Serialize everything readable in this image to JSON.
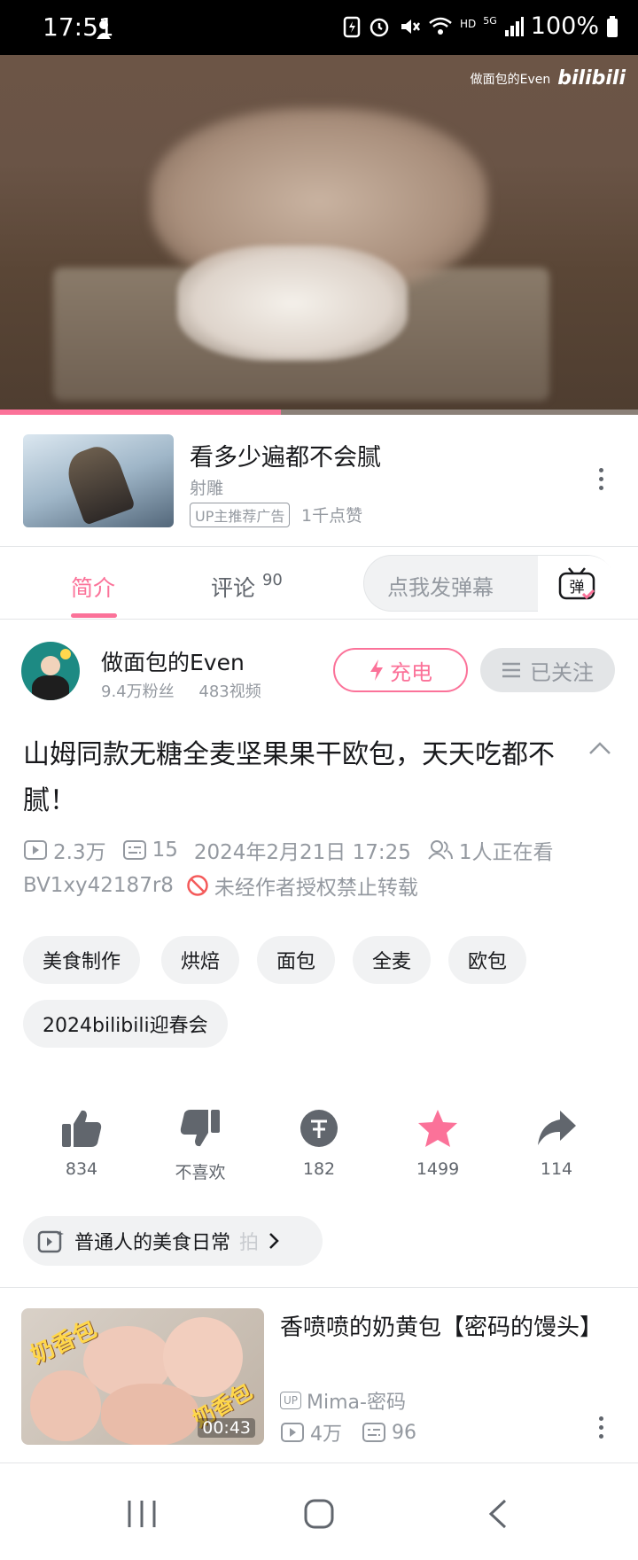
{
  "status_bar": {
    "time": "17:51",
    "network": "5G",
    "hd": "HD",
    "battery": "100%"
  },
  "player": {
    "watermark_name": "做面包的Even",
    "watermark_logo": "bilibili",
    "progress_fraction": 0.44
  },
  "ad": {
    "title": "看多少遍都不会腻",
    "subtitle": "射雕",
    "badge": "UP主推荐广告",
    "likes": "1千点赞"
  },
  "tabs": {
    "intro": "简介",
    "comments": "评论",
    "comments_count": "90",
    "danmaku_placeholder": "点我发弹幕",
    "danmaku_icon_char": "弹"
  },
  "uploader": {
    "name": "做面包的Even",
    "fans": "9.4万粉丝",
    "videos": "483视频",
    "charge_label": "充电",
    "follow_label": "已关注"
  },
  "video": {
    "title": "山姆同款无糖全麦坚果果干欧包，天天吃都不腻！",
    "plays": "2.3万",
    "danmaku": "15",
    "date": "2024年2月21日 17:25",
    "watching": "1人正在看",
    "bvid": "BV1xy42187r8",
    "repost_notice": "未经作者授权禁止转载",
    "tags": [
      "美食制作",
      "烘焙",
      "面包",
      "全麦",
      "欧包",
      "2024bilibili迎春会"
    ]
  },
  "actions": {
    "like": "834",
    "dislike": "不喜欢",
    "coin": "182",
    "favorite": "1499",
    "share": "114"
  },
  "playlist": {
    "label": "普通人的美食日常",
    "fade_char": "拍"
  },
  "recommended": {
    "title": "香喷喷的奶黄包【密码的馒头】",
    "thumb_text_1": "奶香包",
    "thumb_text_2": "奶香包",
    "duration": "00:43",
    "up_tag": "UP",
    "up_name": "Mima-密码",
    "plays": "4万",
    "danmaku": "96"
  },
  "colors": {
    "accent": "#fb7299",
    "text_secondary": "#9499a0"
  }
}
